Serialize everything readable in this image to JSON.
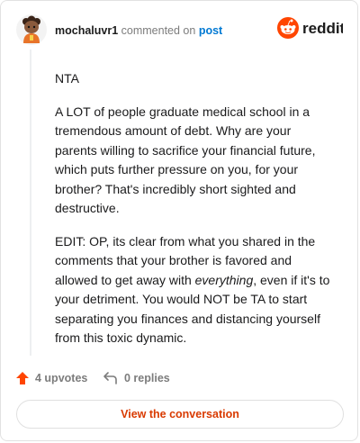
{
  "header": {
    "username": "mochaluvr1",
    "commented_text": "commented on",
    "post_link": "post",
    "brand_name": "reddit"
  },
  "comment": {
    "paragraphs": [
      {
        "text": "NTA"
      },
      {
        "text": "A LOT of people graduate medical school in a tremendous amount of debt. Why are your parents willing to sacrifice your financial future, which puts further pressure on you, for your brother? That's incredibly short sighted and destructive."
      },
      {
        "pre": "EDIT: OP, its clear from what you shared in the comments that your brother is favored and allowed to get away with ",
        "em": "everything",
        "post": ", even if it's to your detriment. You would NOT be TA to start separating you finances and distancing yourself from this toxic dynamic."
      }
    ]
  },
  "footer": {
    "upvotes": "4 upvotes",
    "replies": "0 replies",
    "view_button": "View the conversation"
  },
  "colors": {
    "brand": "#ff4500",
    "link": "#0079d3",
    "view_button_text": "#d93a00"
  },
  "icons": {
    "avatar": "user-avatar",
    "brand": "reddit-snoo-icon",
    "upvote": "upvote-arrow-icon",
    "reply": "reply-arrow-icon"
  }
}
